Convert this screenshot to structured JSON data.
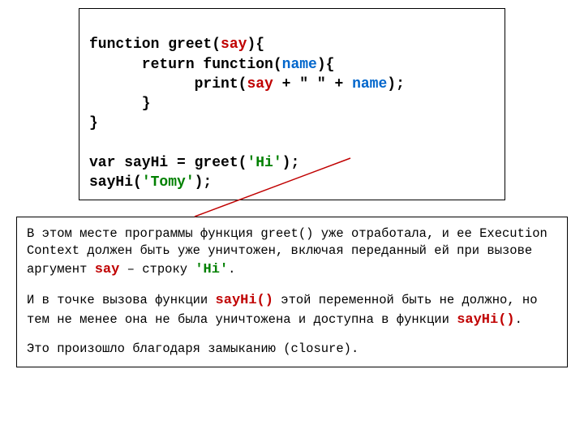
{
  "code": {
    "l1a": "function greet(",
    "l1b": "say",
    "l1c": "){",
    "l2a": "      return function(",
    "l2b": "name",
    "l2c": "){",
    "l3a": "            print(",
    "l3b": "say",
    "l3c": " + \" \" + ",
    "l3d": "name",
    "l3e": ");",
    "l4": "      }",
    "l5": "}",
    "blank": "",
    "l6a": "var sayHi = greet(",
    "l6b": "'Hi'",
    "l6c": ");",
    "l7a": "sayHi(",
    "l7b": "'Tomy'",
    "l7c": ");"
  },
  "explain": {
    "p1a": "В этом месте программы функция greet() уже отработала, и ее Execution Context должен быть уже уничтожен, включая переданный ей при вызове аргумент ",
    "p1b": "say",
    "p1c": " – строку ",
    "p1d": "'Hi'",
    "p1e": ".",
    "p2a": "И в точке вызова функции ",
    "p2b": "sayHi()",
    "p2c": " этой переменной быть не должно, но тем не менее она не была уничтожена и доступна в функции ",
    "p2d": "sayHi()",
    "p2e": ".",
    "p3": "Это произошло благодаря замыканию (closure)."
  }
}
